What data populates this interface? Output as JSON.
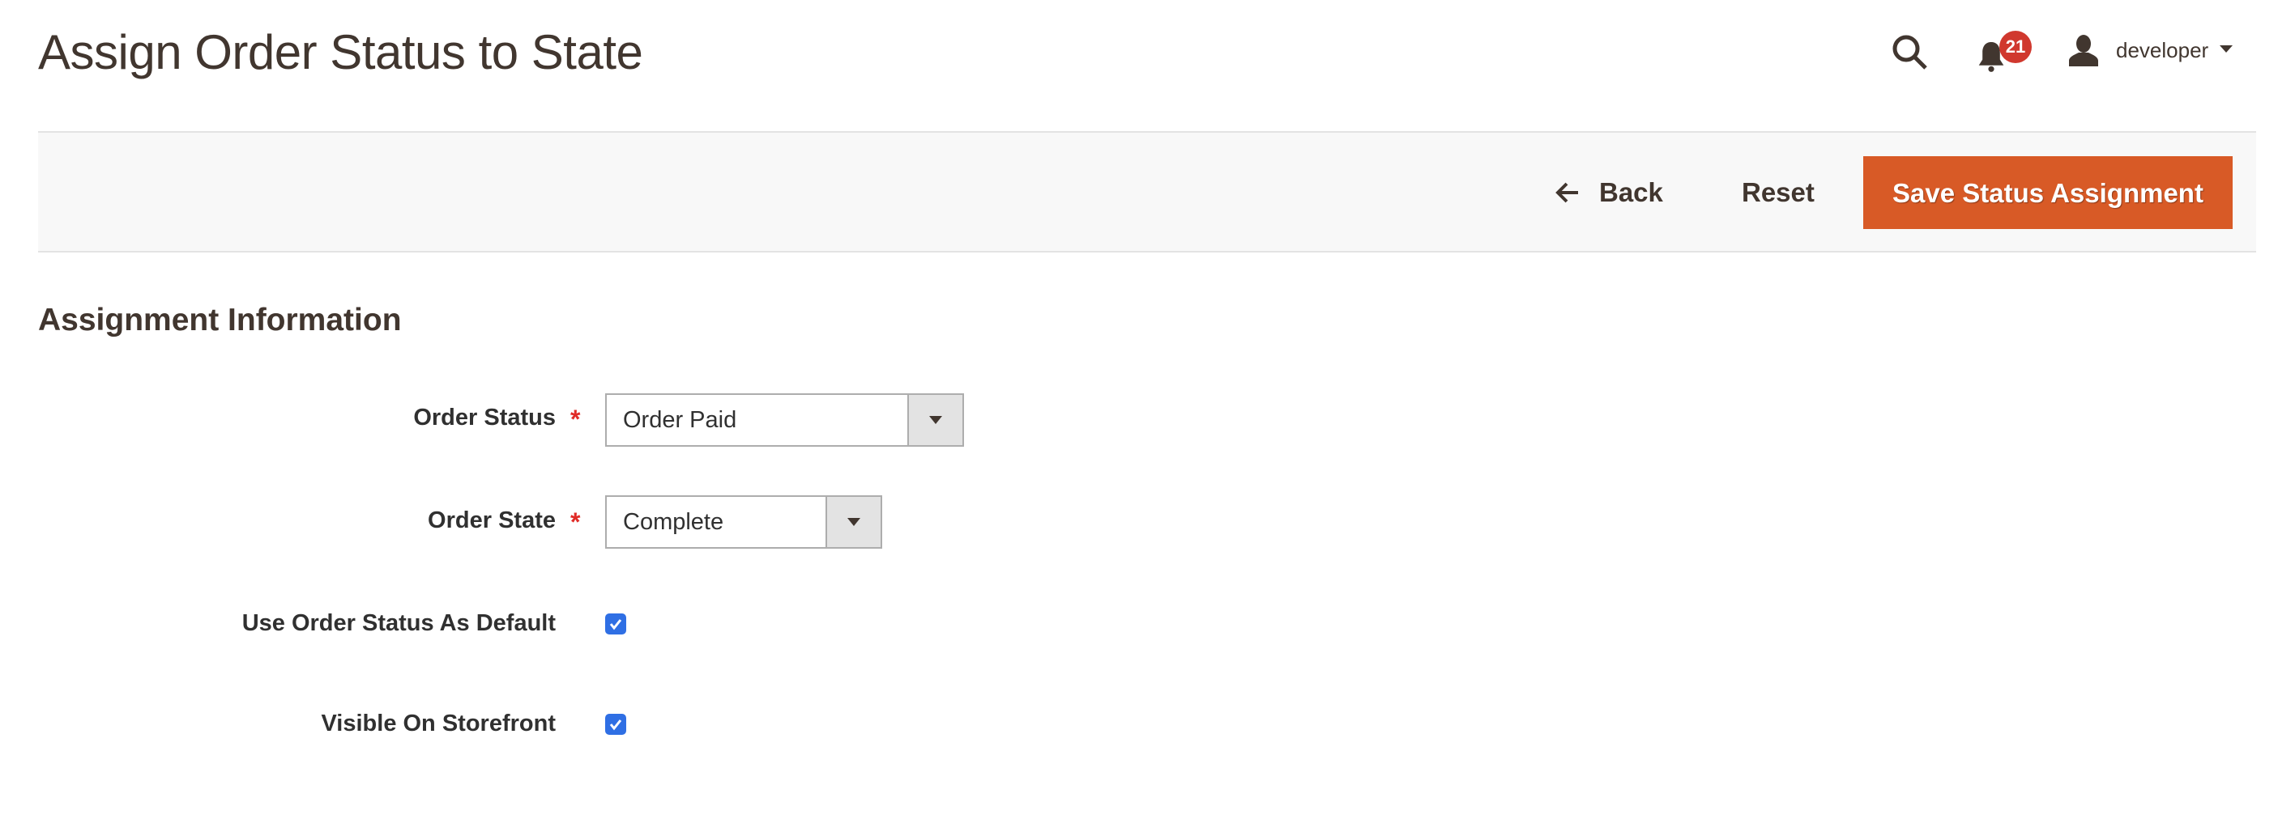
{
  "header": {
    "title": "Assign Order Status to State",
    "notifications_count": "21",
    "user_name": "developer",
    "icons": {
      "search": "search-icon",
      "notifications": "bell-icon",
      "user": "user-icon",
      "user_menu": "caret-down-icon"
    }
  },
  "toolbar": {
    "back_label": "Back",
    "reset_label": "Reset",
    "save_label": "Save Status Assignment",
    "save_color": "#d85a26"
  },
  "section": {
    "title": "Assignment Information"
  },
  "form": {
    "order_status": {
      "label": "Order Status",
      "required_mark": "*",
      "value": "Order Paid"
    },
    "order_state": {
      "label": "Order State",
      "required_mark": "*",
      "value": "Complete"
    },
    "use_as_default": {
      "label": "Use Order Status As Default",
      "checked": true
    },
    "visible_on_storefront": {
      "label": "Visible On Storefront",
      "checked": true
    }
  }
}
